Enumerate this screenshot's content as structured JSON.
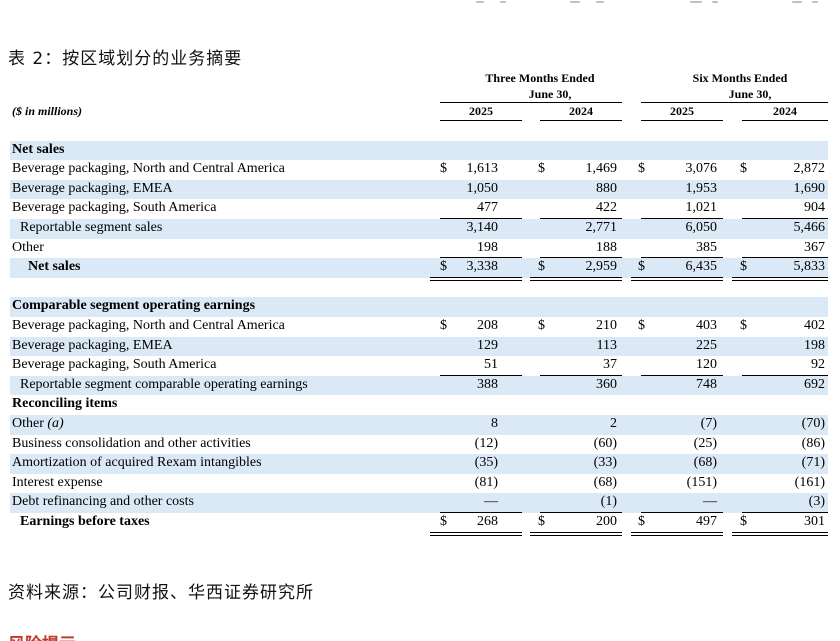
{
  "caption": "表 2：按区域划分的业务摘要",
  "source": "资料来源：公司财报、华西证券研究所",
  "bottom_fragment": "风险提示",
  "header": {
    "units": "($ in millions)",
    "groups": [
      {
        "line1": "Three Months Ended",
        "line2": "June 30,",
        "years": [
          "2025",
          "2024"
        ]
      },
      {
        "line1": "Six Months Ended",
        "line2": "June 30,",
        "years": [
          "2025",
          "2024"
        ]
      }
    ]
  },
  "rows": [
    {
      "label": "",
      "type": "spacer",
      "shade": false,
      "values": []
    },
    {
      "label": "Net sales",
      "type": "section",
      "shade": true,
      "values": []
    },
    {
      "label": "Beverage packaging, North and Central America",
      "type": "data",
      "shade": false,
      "dollar": true,
      "values": [
        "1,613",
        "1,469",
        "3,076",
        "2,872"
      ]
    },
    {
      "label": "Beverage packaging, EMEA",
      "type": "data",
      "shade": true,
      "values": [
        "1,050",
        "880",
        "1,953",
        "1,690"
      ]
    },
    {
      "label": "Beverage packaging, South America",
      "type": "data",
      "shade": false,
      "values": [
        "477",
        "422",
        "1,021",
        "904"
      ],
      "underline": true
    },
    {
      "label": "Reportable segment sales",
      "type": "data",
      "indent": 1,
      "shade": true,
      "values": [
        "3,140",
        "2,771",
        "6,050",
        "5,466"
      ]
    },
    {
      "label": "Other",
      "type": "data",
      "shade": false,
      "values": [
        "198",
        "188",
        "385",
        "367"
      ],
      "underline": true
    },
    {
      "label": "Net sales",
      "type": "total",
      "indent": 2,
      "shade": true,
      "dollar": true,
      "values": [
        "3,338",
        "2,959",
        "6,435",
        "5,833"
      ]
    },
    {
      "label": "",
      "type": "spacer",
      "shade": false,
      "values": []
    },
    {
      "label": "Comparable segment operating earnings",
      "type": "section",
      "shade": true,
      "values": []
    },
    {
      "label": "Beverage packaging, North and Central America",
      "type": "data",
      "shade": false,
      "dollar": true,
      "values": [
        "208",
        "210",
        "403",
        "402"
      ]
    },
    {
      "label": "Beverage packaging, EMEA",
      "type": "data",
      "shade": true,
      "values": [
        "129",
        "113",
        "225",
        "198"
      ]
    },
    {
      "label": "Beverage packaging, South America",
      "type": "data",
      "shade": false,
      "values": [
        "51",
        "37",
        "120",
        "92"
      ],
      "underline": true
    },
    {
      "label": "Reportable segment comparable operating earnings",
      "type": "data",
      "indent": 1,
      "shade": true,
      "values": [
        "388",
        "360",
        "748",
        "692"
      ]
    },
    {
      "label": "Reconciling items",
      "type": "section",
      "shade": false,
      "values": []
    },
    {
      "label": "Other (a)",
      "type": "data",
      "shade": true,
      "values": [
        "8",
        "2",
        "(7)",
        "(70)"
      ]
    },
    {
      "label": "Business consolidation and other activities",
      "type": "data",
      "shade": false,
      "values": [
        "(12)",
        "(60)",
        "(25)",
        "(86)"
      ]
    },
    {
      "label": "Amortization of acquired Rexam intangibles",
      "type": "data",
      "shade": true,
      "values": [
        "(35)",
        "(33)",
        "(68)",
        "(71)"
      ]
    },
    {
      "label": "Interest expense",
      "type": "data",
      "shade": false,
      "values": [
        "(81)",
        "(68)",
        "(151)",
        "(161)"
      ]
    },
    {
      "label": "Debt refinancing and other costs",
      "type": "data",
      "shade": true,
      "values": [
        "—",
        "(1)",
        "—",
        "(3)"
      ],
      "underline": true
    },
    {
      "label": "Earnings before taxes",
      "type": "total",
      "indent": 1,
      "shade": false,
      "dollar": true,
      "values": [
        "268",
        "200",
        "497",
        "301"
      ]
    }
  ]
}
